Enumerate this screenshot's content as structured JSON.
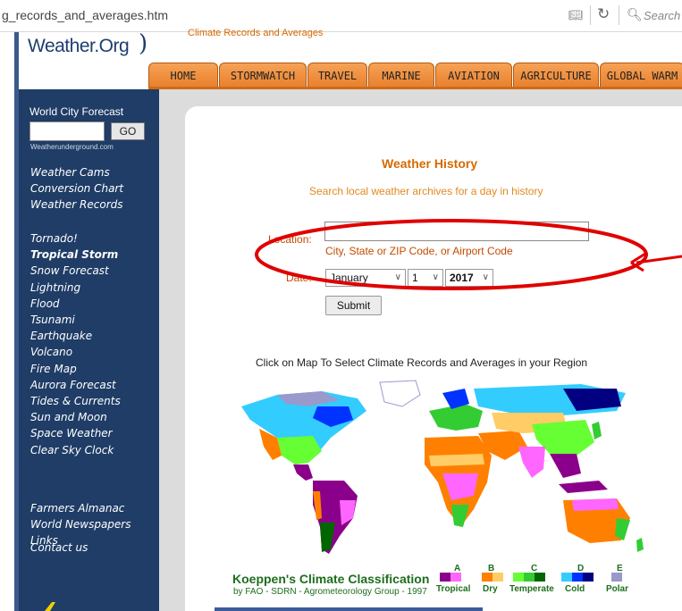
{
  "browser": {
    "url": "g_records_and_averages.htm",
    "search_placeholder": "Search"
  },
  "header": {
    "logo": "Weather.Org",
    "tagline": "Climate Records and Averages"
  },
  "nav": {
    "tabs": [
      "HOME",
      "STORMWATCH",
      "TRAVEL",
      "MARINE",
      "AVIATION",
      "AGRICULTURE",
      "GLOBAL WARM"
    ]
  },
  "sidebar": {
    "forecast_title": "World City Forecast",
    "go_label": "GO",
    "provider": "Weatherunderground.com",
    "links_group1": [
      "Weather Cams",
      "Conversion Chart",
      "Weather Records"
    ],
    "links_group2": [
      "Tornado!",
      "Tropical Storm",
      "Snow Forecast",
      "Lightning",
      "Flood",
      "Tsunami",
      "Earthquake",
      "Volcano",
      "Fire Map",
      "Aurora Forecast",
      "Tides & Currents",
      "Sun and Moon",
      "Space Weather",
      "Clear Sky Clock"
    ],
    "links_group3": [
      "Farmers Almanac",
      "World Newspapers",
      "Links"
    ],
    "contact": "Contact us"
  },
  "main": {
    "title": "Weather History",
    "subtitle": "Search local weather archives for a day in history",
    "location_label": "Location:",
    "location_value": "",
    "location_hint": "City, State or ZIP Code, or Airport Code",
    "date_label": "Date:",
    "month": "January",
    "day": "1",
    "year": "2017",
    "submit_label": "Submit",
    "map_caption": "Click on Map To Select Climate Records and Averages in your Region"
  },
  "legend": {
    "title": "Koeppen's Climate Classification",
    "subtitle": "by FAO - SDRN - Agrometeorology Group - 1997",
    "classes": [
      {
        "letter": "A",
        "name": "Tropical",
        "colors": [
          "#8a008a",
          "#ff66ff"
        ]
      },
      {
        "letter": "B",
        "name": "Dry",
        "colors": [
          "#ff8000",
          "#ffcc66"
        ]
      },
      {
        "letter": "C",
        "name": "Temperate",
        "colors": [
          "#66ff33",
          "#33cc33",
          "#006600"
        ]
      },
      {
        "letter": "D",
        "name": "Cold",
        "colors": [
          "#33ccff",
          "#0033ff",
          "#000080"
        ]
      },
      {
        "letter": "E",
        "name": "Polar",
        "colors": [
          "#9999cc"
        ]
      }
    ]
  },
  "colors": {
    "sidebar_bg": "#1f3d66",
    "tab_orange": "#f39a4c",
    "heading_orange": "#d56a00",
    "annotation_red": "#e00000"
  }
}
